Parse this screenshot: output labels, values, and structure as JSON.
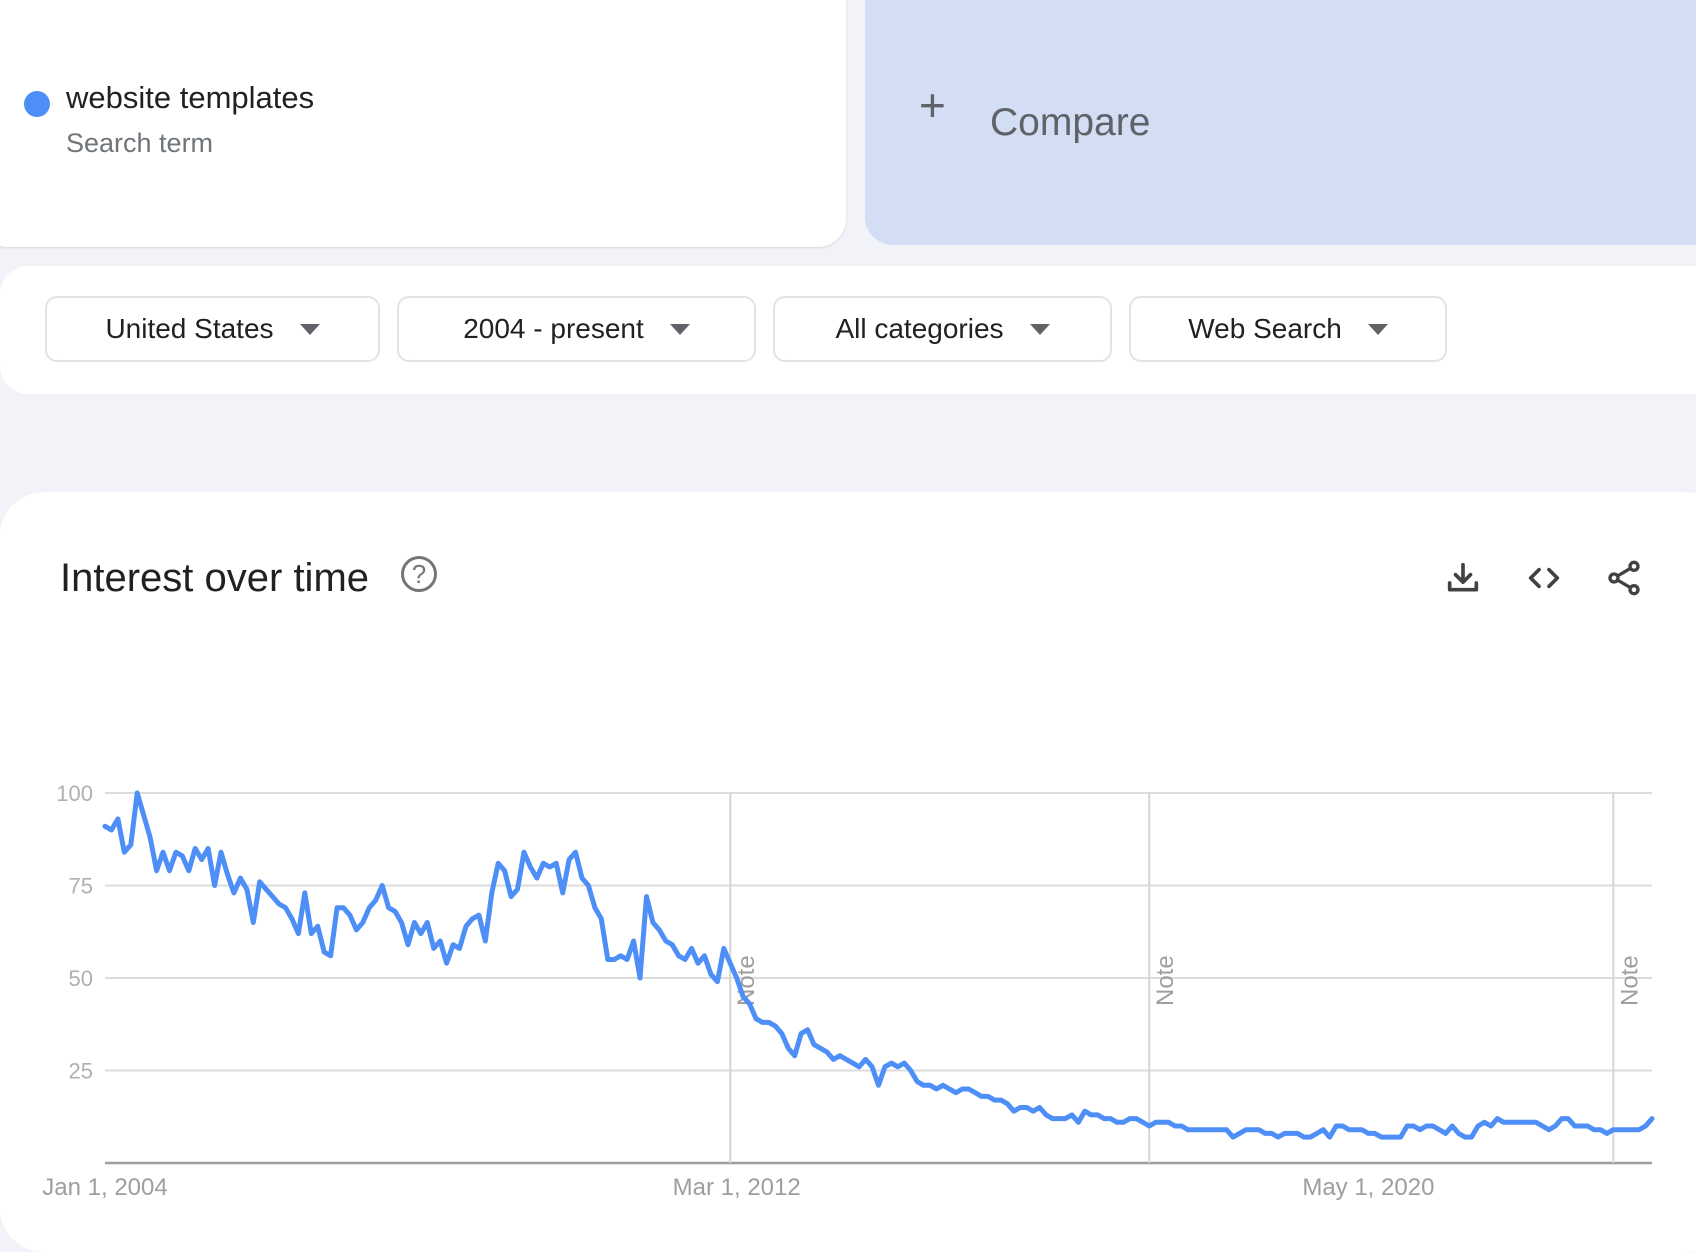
{
  "search_term": {
    "name": "website templates",
    "type_label": "Search term",
    "color": "#4e8ef7"
  },
  "compare": {
    "icon": "plus-icon",
    "label": "Compare"
  },
  "filters": [
    {
      "label": "United States",
      "icon": "dropdown-arrow-icon"
    },
    {
      "label": "2004 - present",
      "icon": "dropdown-arrow-icon"
    },
    {
      "label": "All categories",
      "icon": "dropdown-arrow-icon"
    },
    {
      "label": "Web Search",
      "icon": "dropdown-arrow-icon"
    }
  ],
  "chart_section": {
    "title": "Interest over time",
    "help_icon": "help-circle-icon",
    "help_glyph": "?",
    "actions": [
      {
        "name": "download",
        "icon": "download-icon"
      },
      {
        "name": "embed",
        "icon": "code-icon"
      },
      {
        "name": "share",
        "icon": "share-icon"
      }
    ]
  },
  "chart_data": {
    "type": "line",
    "title": "Interest over time",
    "xlabel": "",
    "ylabel": "",
    "ylim": [
      0,
      100
    ],
    "yticks": [
      25,
      50,
      75,
      100
    ],
    "ytick_labels": [
      "25",
      "50",
      "75",
      "100"
    ],
    "x_start": "2004-01",
    "x_end": "2023-12",
    "x_unit": "month",
    "xtick_labels": [
      {
        "label": "Jan 1, 2004",
        "month_index": 0
      },
      {
        "label": "Mar 1, 2012",
        "month_index": 98
      },
      {
        "label": "May 1, 2020",
        "month_index": 196
      }
    ],
    "annotations": [
      {
        "label": "Note",
        "month_index": 97
      },
      {
        "label": "Note",
        "month_index": 162
      },
      {
        "label": "Note",
        "month_index": 234
      }
    ],
    "grid": true,
    "legend": "none",
    "series": [
      {
        "name": "website templates",
        "color": "#4e8ef7",
        "values": [
          91,
          90,
          93,
          84,
          86,
          100,
          94,
          88,
          79,
          84,
          79,
          84,
          83,
          79,
          85,
          82,
          85,
          75,
          84,
          78,
          73,
          77,
          74,
          65,
          76,
          74,
          72,
          70,
          69,
          66,
          62,
          73,
          62,
          64,
          57,
          56,
          69,
          69,
          67,
          63,
          65,
          69,
          71,
          75,
          69,
          68,
          65,
          59,
          65,
          62,
          65,
          58,
          60,
          54,
          59,
          58,
          64,
          66,
          67,
          60,
          73,
          81,
          79,
          72,
          74,
          84,
          80,
          77,
          81,
          80,
          81,
          73,
          82,
          84,
          77,
          75,
          69,
          66,
          55,
          55,
          56,
          55,
          60,
          50,
          72,
          65,
          63,
          60,
          59,
          56,
          55,
          58,
          54,
          56,
          51,
          49,
          58,
          54,
          50,
          45,
          43,
          39,
          38,
          38,
          37,
          35,
          31,
          29,
          35,
          36,
          32,
          31,
          30,
          28,
          29,
          28,
          27,
          26,
          28,
          26,
          21,
          26,
          27,
          26,
          27,
          25,
          22,
          21,
          21,
          20,
          21,
          20,
          19,
          20,
          20,
          19,
          18,
          18,
          17,
          17,
          16,
          14,
          15,
          15,
          14,
          15,
          13,
          12,
          12,
          12,
          13,
          11,
          14,
          13,
          13,
          12,
          12,
          11,
          11,
          12,
          12,
          11,
          10,
          11,
          11,
          11,
          10,
          10,
          9,
          9,
          9,
          9,
          9,
          9,
          9,
          7,
          8,
          9,
          9,
          9,
          8,
          8,
          7,
          8,
          8,
          8,
          7,
          7,
          8,
          9,
          7,
          10,
          10,
          9,
          9,
          9,
          8,
          8,
          7,
          7,
          7,
          7,
          10,
          10,
          9,
          10,
          10,
          9,
          8,
          10,
          8,
          7,
          7,
          10,
          11,
          10,
          12,
          11,
          11,
          11,
          11,
          11,
          11,
          10,
          9,
          10,
          12,
          12,
          10,
          10,
          10,
          9,
          9,
          8,
          9,
          9,
          9,
          9,
          9,
          10,
          12
        ]
      }
    ]
  }
}
